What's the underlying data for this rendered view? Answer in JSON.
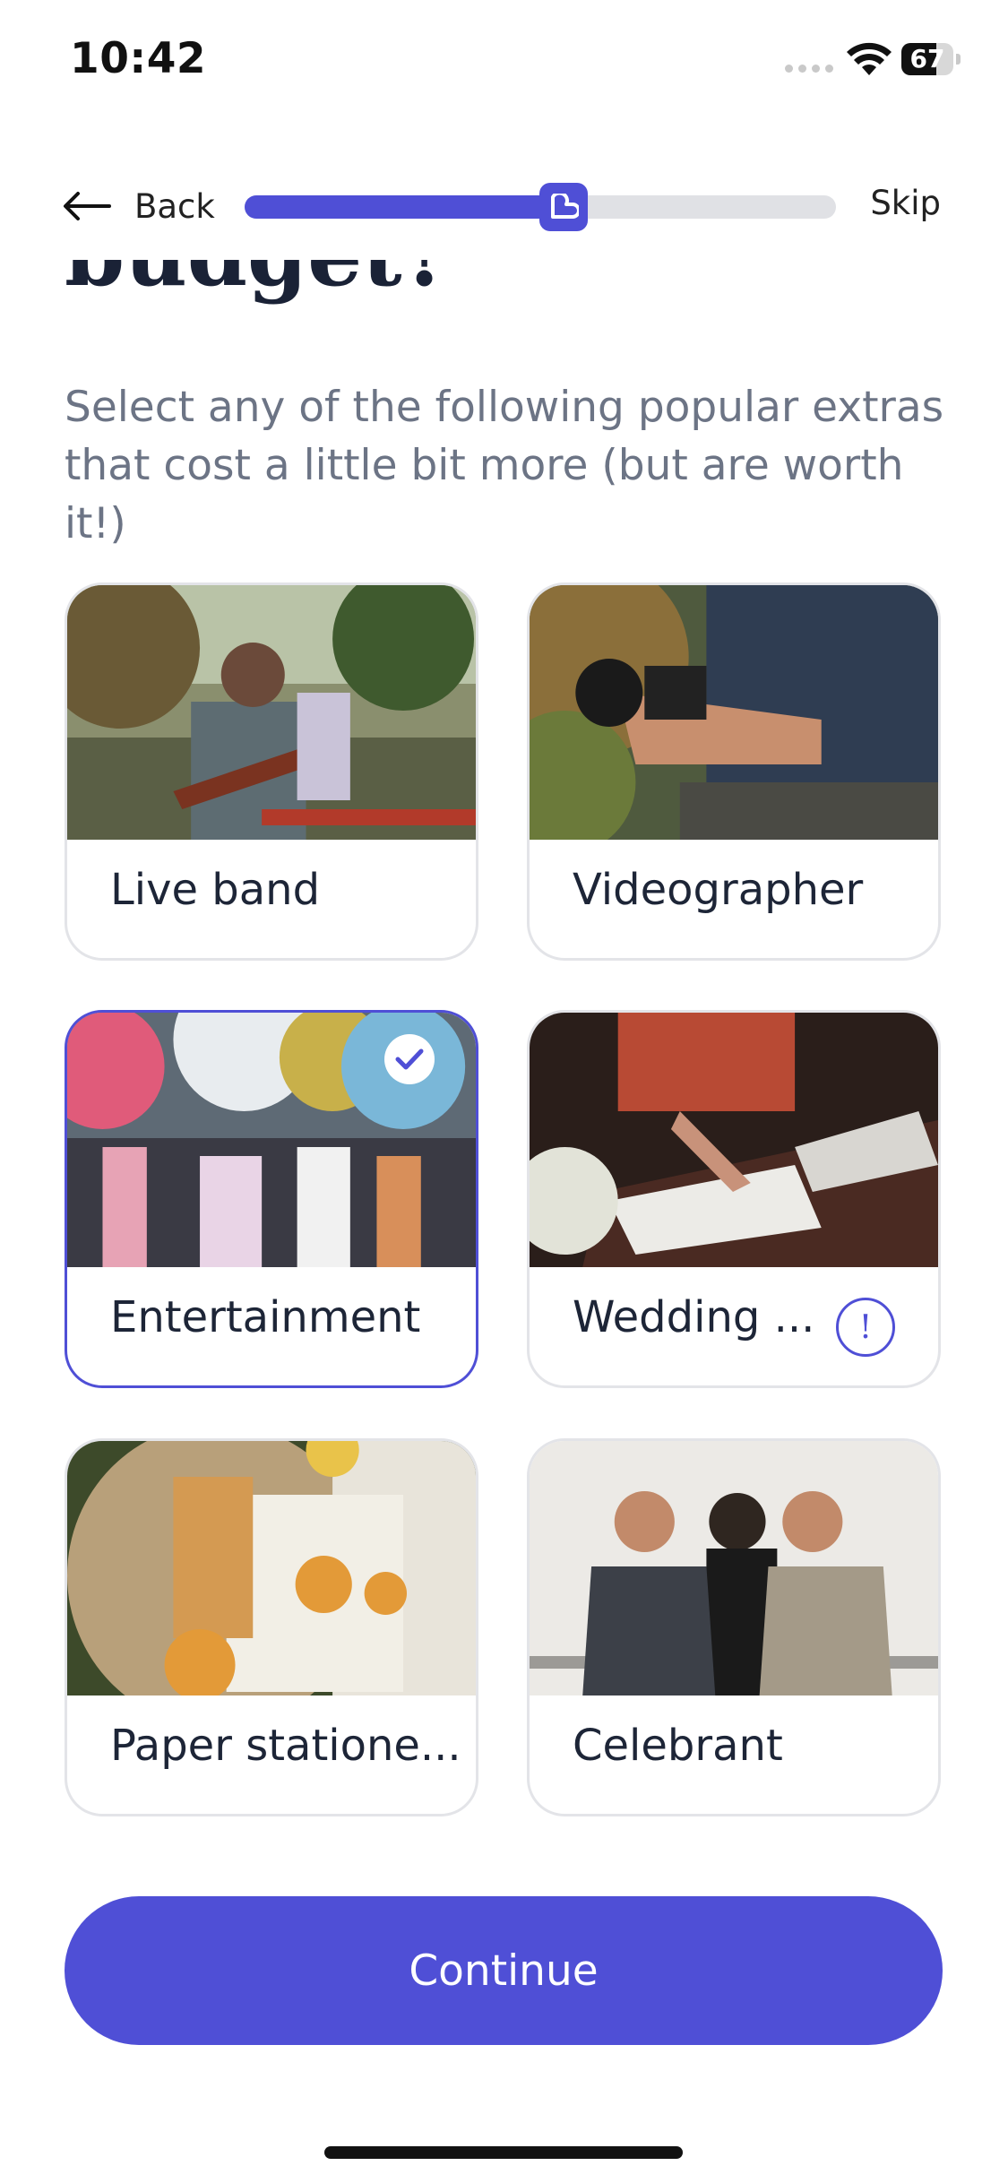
{
  "status_bar": {
    "time": "10:42",
    "battery_level": "67",
    "battery_fraction": 0.67
  },
  "nav": {
    "back_label": "Back",
    "skip_label": "Skip",
    "progress_fraction": 0.54
  },
  "heading": {
    "title": "budget?",
    "subtitle": "Select any of the following popular extras that cost a little bit more (but are worth it!)"
  },
  "options": [
    {
      "label": "Live band",
      "selected": false
    },
    {
      "label": "Videographer",
      "selected": false
    },
    {
      "label": "Entertainment",
      "selected": true
    },
    {
      "label": "Wedding ...",
      "selected": false,
      "info": "!"
    },
    {
      "label": "Paper statione...",
      "selected": false
    },
    {
      "label": "Celebrant",
      "selected": false
    }
  ],
  "continue_label": "Continue",
  "colors": {
    "accent": "#4f4fd6",
    "title": "#1a2236",
    "subtitle": "#6c7485",
    "card_border": "#e3e4e8"
  }
}
